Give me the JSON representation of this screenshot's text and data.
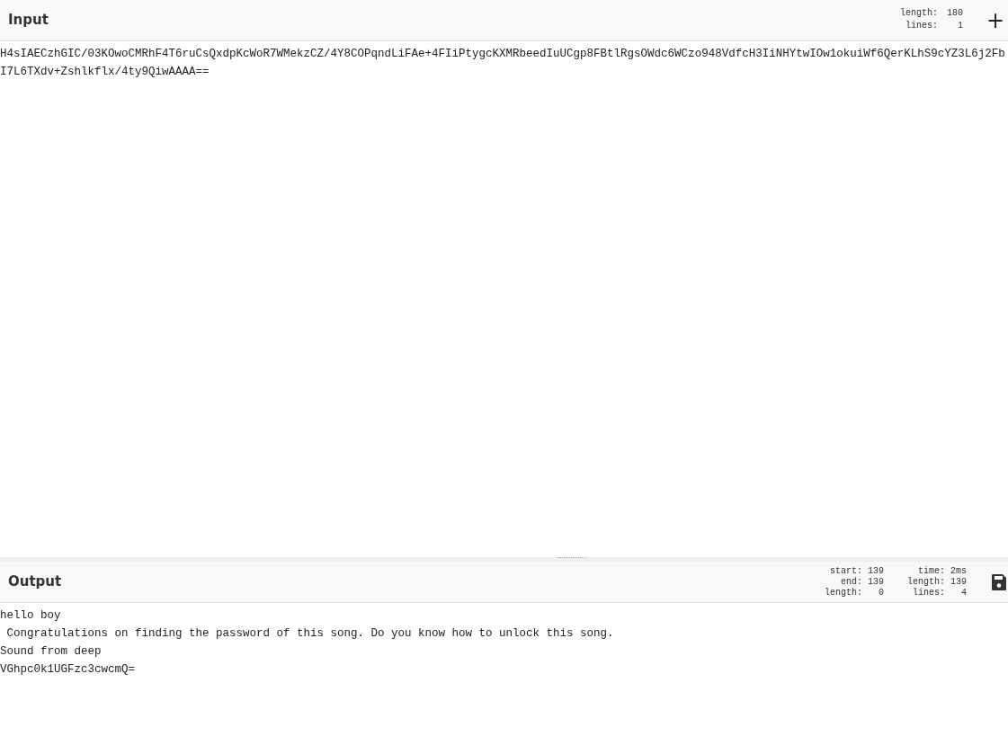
{
  "input": {
    "title": "Input",
    "stats": [
      {
        "label": "length:",
        "value": "180"
      },
      {
        "label": "lines:",
        "value": "1"
      }
    ],
    "add_button": "+",
    "text": "H4sIAECzhGIC/03KOwoCMRhF4T6ruCsQxdpKcWoR7WMekzCZ/4Y8COPqndLiFAe+4FIiPtygcKXMRbeedIuUCgp8FBtlRgsOWdc6WCzo948VdfcH3IiNHYtwIOw1okuiWf6QerKLhS9cYZ3L6j2FbI7L6TXdv+Zshlkflx/4ty9QiwAAAA=="
  },
  "output": {
    "title": "Output",
    "stats": [
      {
        "label": "start:",
        "value": "139"
      },
      {
        "label": "end:",
        "value": "139"
      },
      {
        "label": "length:",
        "value": "0"
      },
      {
        "label": "time:",
        "value": "2ms"
      },
      {
        "label": "length:",
        "value": "139"
      },
      {
        "label": "lines:",
        "value": "4"
      }
    ],
    "lines": [
      "hello boy",
      " Congratulations on finding the password of this song. Do you know how to unlock this song.",
      "Sound from deep",
      "VGhpc0k1UGFzc3cwcmQ="
    ]
  }
}
